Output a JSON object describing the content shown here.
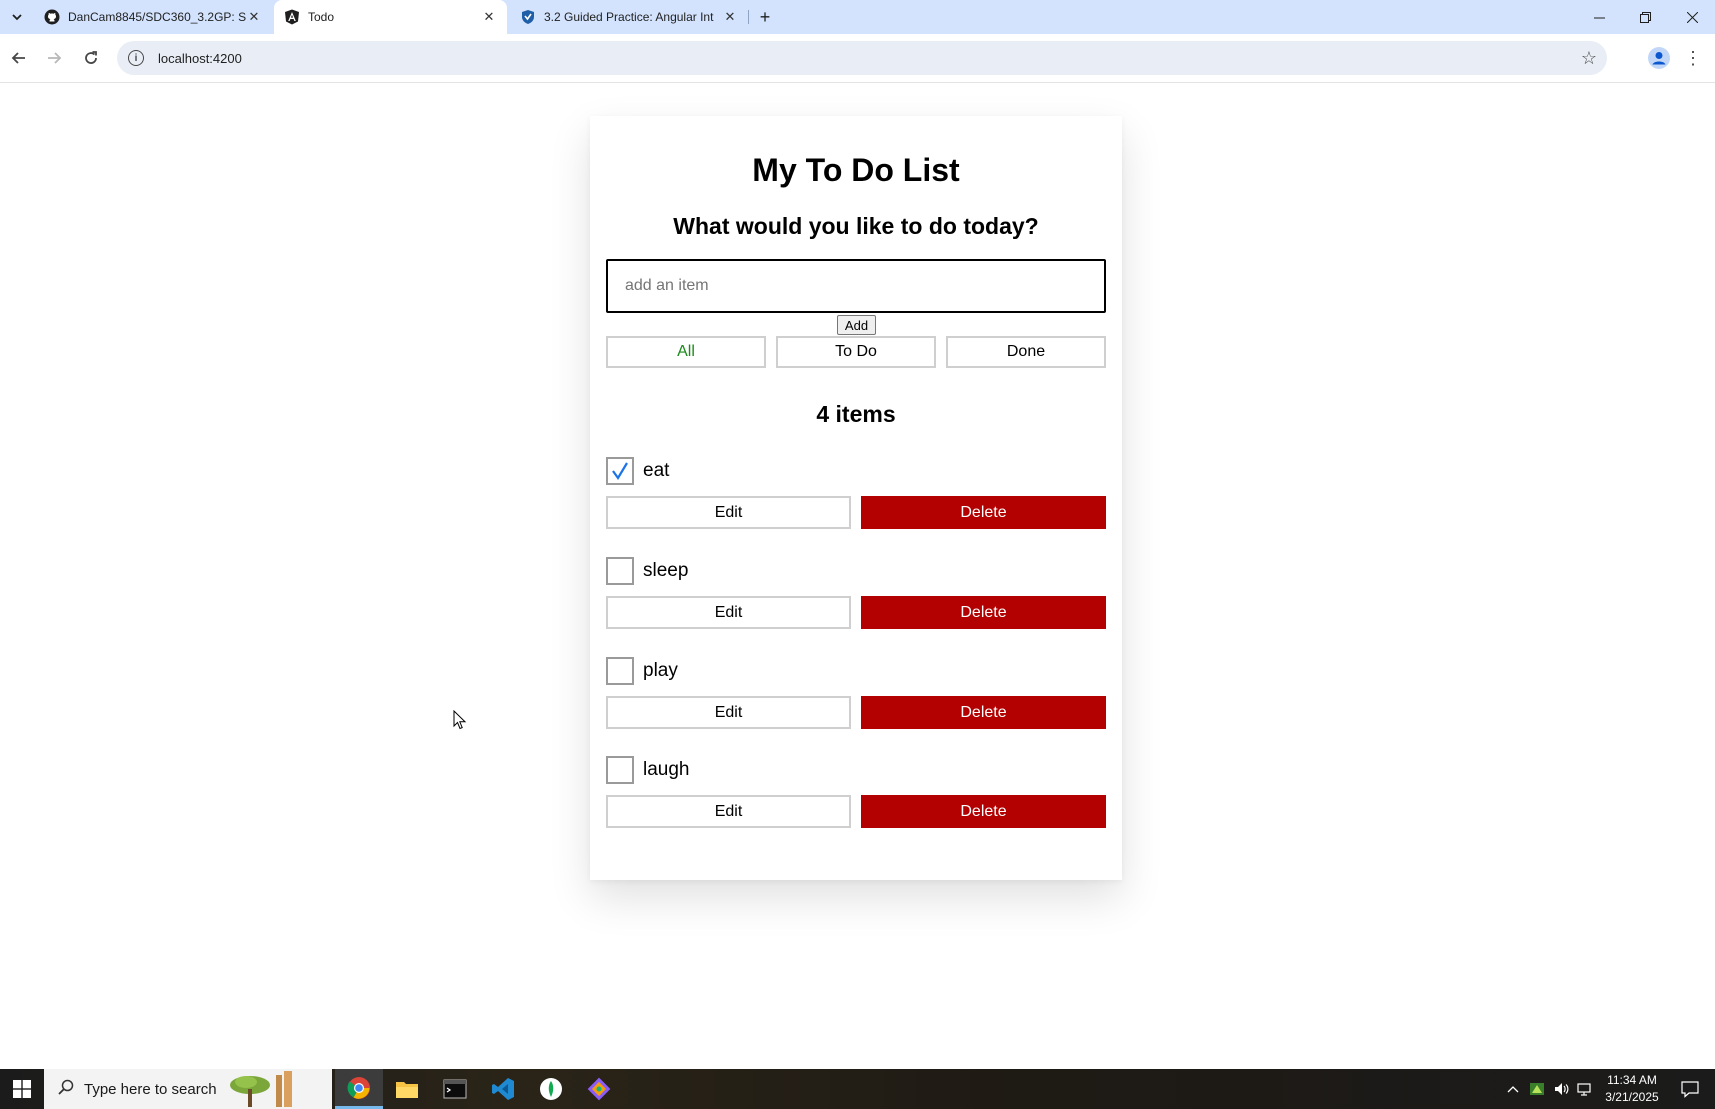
{
  "browser": {
    "tabs": [
      {
        "title": "DanCam8845/SDC360_3.2GP: SD",
        "favicon": "github-icon",
        "active": false
      },
      {
        "title": "Todo",
        "favicon": "angular-icon",
        "active": true
      },
      {
        "title": "3.2 Guided Practice: Angular Int",
        "favicon": "shield-icon",
        "active": false
      }
    ],
    "url": "localhost:4200"
  },
  "app": {
    "title": "My To Do List",
    "prompt": "What would you like to do today?",
    "input_placeholder": "add an item",
    "input_value": "",
    "add_label": "Add",
    "filters": [
      {
        "label": "All",
        "selected": true
      },
      {
        "label": "To Do",
        "selected": false
      },
      {
        "label": "Done",
        "selected": false
      }
    ],
    "count_label": "4 items",
    "items": [
      {
        "description": "eat",
        "done": true,
        "edit_label": "Edit",
        "delete_label": "Delete"
      },
      {
        "description": "sleep",
        "done": false,
        "edit_label": "Edit",
        "delete_label": "Delete"
      },
      {
        "description": "play",
        "done": false,
        "edit_label": "Edit",
        "delete_label": "Delete"
      },
      {
        "description": "laugh",
        "done": false,
        "edit_label": "Edit",
        "delete_label": "Delete"
      }
    ]
  },
  "taskbar": {
    "search_placeholder": "Type here to search",
    "time": "11:34 AM",
    "date": "3/21/2025"
  },
  "colors": {
    "delete_red": "#b30000",
    "filter_selected_green": "#1a8a1a",
    "checkmark_blue": "#1a73e8",
    "tabstrip_blue": "#d3e3fd"
  }
}
